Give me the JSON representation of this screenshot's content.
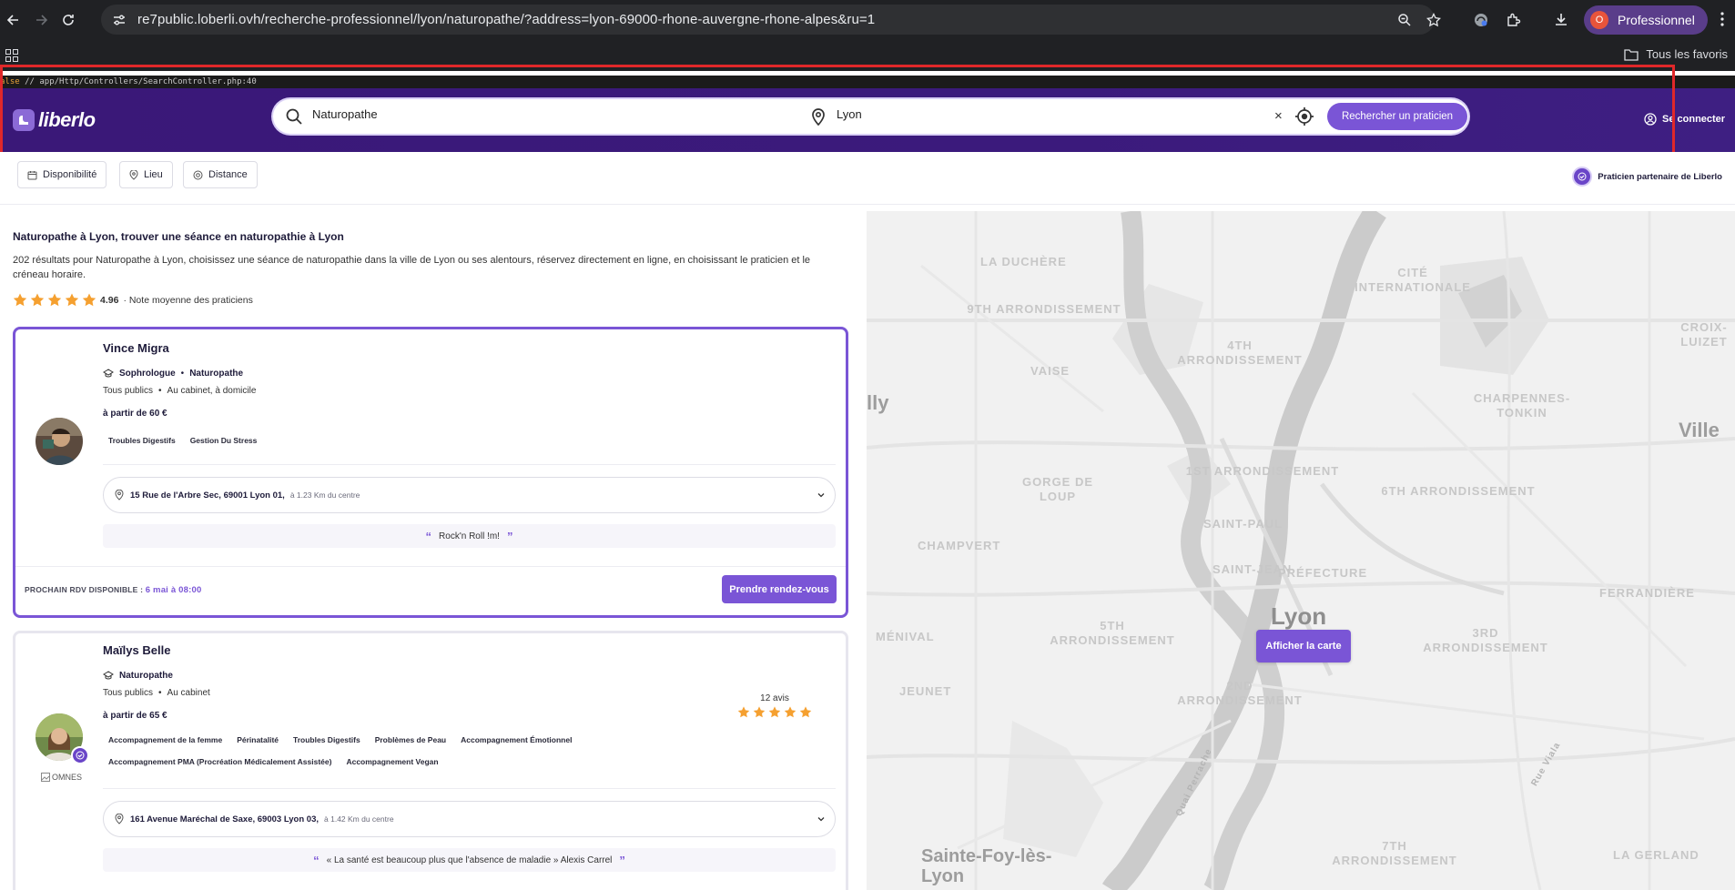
{
  "browser": {
    "url": "re7public.loberli.ovh/recherche-professionnel/lyon/naturopathe/?address=lyon-69000-rhone-auvergne-rhone-alpes&ru=1",
    "profile_label": "Professionnel",
    "profile_initial": "O",
    "bookmarks_label": "Tous les favoris"
  },
  "debug": {
    "keyword": "alse",
    "text": " // app/Http/Controllers/SearchController.php:40"
  },
  "header": {
    "logo_text": "liberlo",
    "specialty_value": "Naturopathe",
    "location_value": "Lyon",
    "clear_symbol": "×",
    "search_button": "Rechercher un praticien",
    "login_label": "Se connecter"
  },
  "filters": {
    "availability": "Disponibilité",
    "place": "Lieu",
    "distance": "Distance",
    "partner_label": "Praticien partenaire de Liberlo"
  },
  "results": {
    "title": "Naturopathe à Lyon, trouver une séance en naturopathie à Lyon",
    "description": "202 résultats pour Naturopathe à Lyon, choisissez une séance de naturopathie dans la ville de Lyon ou ses alentours, réservez directement en ligne, en choisissant le praticien et le créneau horaire.",
    "average_rating": "4.96",
    "average_rating_label": "· Note moyenne des praticiens",
    "average_stars": 5
  },
  "practitioners": [
    {
      "name": "Vince Migra",
      "specialties": [
        "Sophrologue",
        "Naturopathe"
      ],
      "public": "Tous publics",
      "modes": "Au cabinet, à domicile",
      "price": "à partir de 60 €",
      "tags": [
        "Troubles Digestifs",
        "Gestion Du Stress"
      ],
      "address": "15 Rue de l'Arbre Sec, 69001 Lyon 01,",
      "distance": "à 1.23 Km du centre",
      "quote": "Rock'n Roll !m!",
      "next_label": "PROCHAIN RDV DISPONIBLE :",
      "next_date": "6 mai à 08:00",
      "cta": "Prendre rendez-vous"
    },
    {
      "name": "Maïlys Belle",
      "specialties": [
        "Naturopathe"
      ],
      "public": "Tous publics",
      "modes": "Au cabinet",
      "price": "à partir de 65 €",
      "tags": [
        "Accompagnement de la femme",
        "Périnatalité",
        "Troubles Digestifs",
        "Problèmes de Peau",
        "Accompagnement Émotionnel",
        "Accompagnement PMA (Procréation Médicalement Assistée)",
        "Accompagnement Vegan"
      ],
      "reviews": "12 avis",
      "review_stars": 5,
      "broken_image_alt": "OMNES",
      "address": "161 Avenue Maréchal de Saxe, 69003 Lyon 03,",
      "distance": "à 1.42 Km du centre",
      "quote": "« La santé est beaucoup plus que l'absence de maladie » Alexis Carrel"
    }
  ],
  "map": {
    "button": "Afficher la carte",
    "labels": {
      "duchere": "LA DUCHÈRE",
      "arr9": "9TH ARRONDISSEMENT",
      "vaise": "VAISE",
      "arr4": "4TH ARRONDISSEMENT",
      "internationale": "CITÉ INTERNATIONALE",
      "croix": "CROIX-LUIZET",
      "charpennes": "CHARPENNES-TONKIN",
      "gorge": "GORGE DE LOUP",
      "arr1": "1ST ARRONDISSEMENT",
      "arr6": "6TH ARRONDISSEMENT",
      "saintpaul": "SAINT-PAUL",
      "champvert": "CHAMPVERT",
      "saintjean": "SAINT-JEAN",
      "prefecture": "PRÉFECTURE",
      "ferrandiere": "FERRANDIÈRE",
      "menival": "MÉNIVAL",
      "arr5": "5TH ARRONDISSEMENT",
      "arr3": "3RD ARRONDISSEMENT",
      "jeunet": "JEUNET",
      "arr2": "2ND ARRONDISSEMENT",
      "arr7": "7TH ARRONDISSEMENT",
      "gerland": "LA GERLAND",
      "city_lyon": "Lyon",
      "city_ville": "Ville",
      "city_left": "lly",
      "city_sainte_foy": "Sainte-Foy-lès-Lyon",
      "quai": "Quai Perrache",
      "rue_viala": "Rue Viala"
    }
  }
}
